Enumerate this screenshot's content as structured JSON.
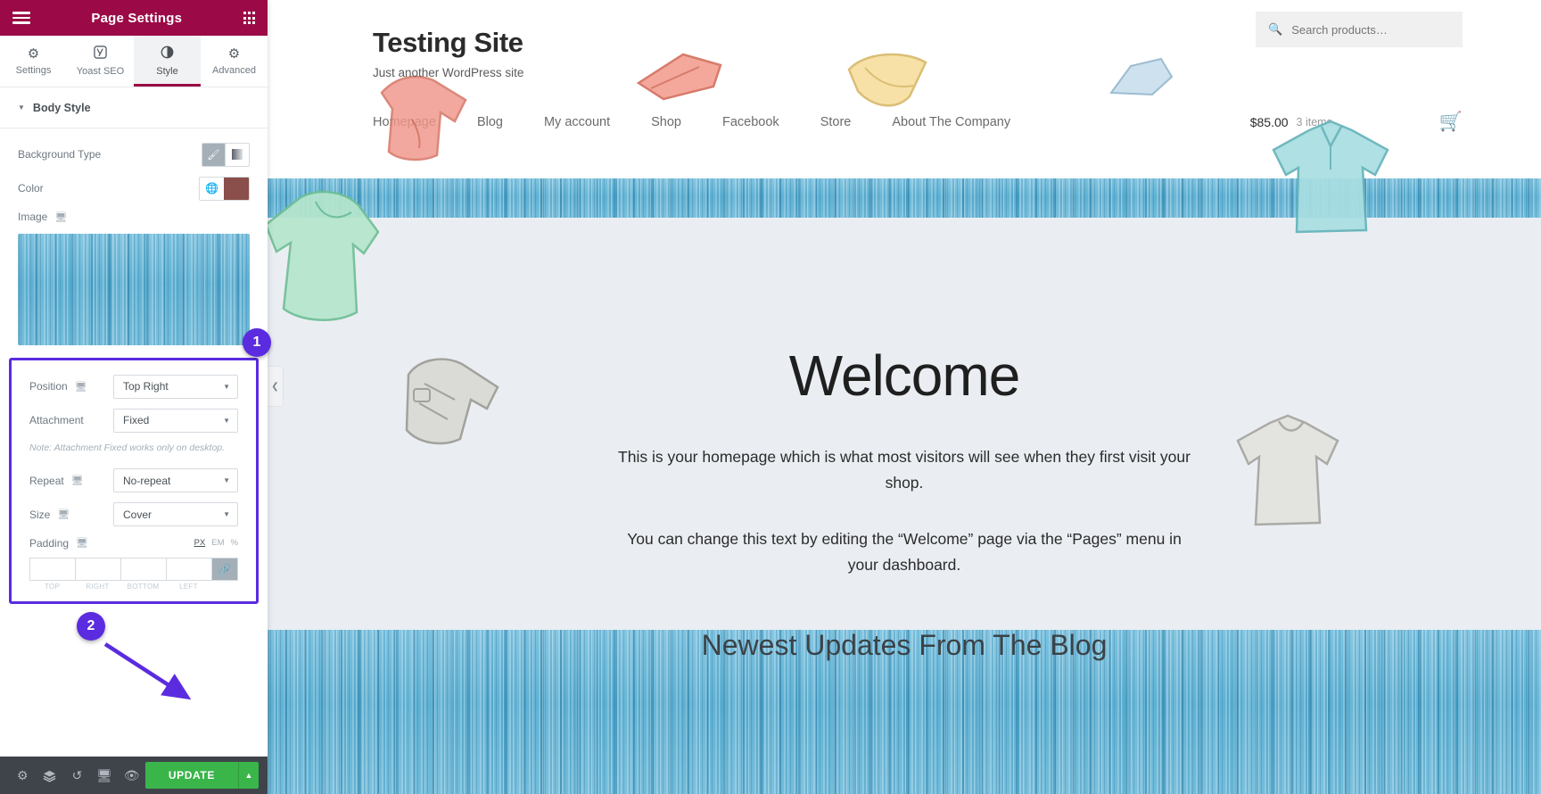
{
  "panel": {
    "header": {
      "title": "Page Settings",
      "menu_icon": "hamburger-icon",
      "apps_icon": "grid-apps-icon"
    },
    "tabs": [
      {
        "label": "Settings",
        "icon": "gear-icon",
        "active": false
      },
      {
        "label": "Yoast SEO",
        "icon": "yoast-logo-icon",
        "active": false
      },
      {
        "label": "Style",
        "icon": "contrast-circle-icon",
        "active": true
      },
      {
        "label": "Advanced",
        "icon": "gear-icon",
        "active": false
      }
    ],
    "section": {
      "title": "Body Style",
      "caret": "▼"
    },
    "controls": {
      "background_type": {
        "label": "Background Type",
        "options": [
          {
            "icon": "brush-icon",
            "selected": true
          },
          {
            "icon": "gradient-icon",
            "selected": false
          }
        ]
      },
      "color": {
        "label": "Color",
        "globe_icon": "globe-icon",
        "value": "#8a4f4a"
      },
      "image": {
        "label": "Image",
        "device_icon": "desktop-icon"
      },
      "position": {
        "label": "Position",
        "device_icon": "desktop-icon",
        "value": "Top Right"
      },
      "attachment": {
        "label": "Attachment",
        "value": "Fixed"
      },
      "attachment_note": "Note: Attachment Fixed works only on desktop.",
      "repeat": {
        "label": "Repeat",
        "device_icon": "desktop-icon",
        "value": "No-repeat"
      },
      "size": {
        "label": "Size",
        "device_icon": "desktop-icon",
        "value": "Cover"
      },
      "padding": {
        "label": "Padding",
        "device_icon": "desktop-icon",
        "units": [
          {
            "label": "PX",
            "selected": true
          },
          {
            "label": "EM",
            "selected": false
          },
          {
            "label": "%",
            "selected": false
          }
        ],
        "fields": [
          {
            "caption": "TOP",
            "value": ""
          },
          {
            "caption": "RIGHT",
            "value": ""
          },
          {
            "caption": "BOTTOM",
            "value": ""
          },
          {
            "caption": "LEFT",
            "value": ""
          }
        ],
        "link_icon": "chain-link-icon"
      }
    },
    "footer": {
      "icons": [
        "gear-icon",
        "layers-icon",
        "history-icon",
        "responsive-desktop-icon",
        "preview-eye-icon"
      ],
      "update_label": "UPDATE",
      "update_caret": "▲",
      "update_color": "#39b54a"
    }
  },
  "preview": {
    "collapse_icon": "chevron-left-icon",
    "site": {
      "title": "Testing Site",
      "tagline": "Just another WordPress site",
      "search": {
        "placeholder": "Search products…",
        "value": "",
        "icon": "search-icon"
      },
      "nav": [
        "Homepage",
        "Blog",
        "My account",
        "Shop",
        "Facebook",
        "Store",
        "About The Company"
      ],
      "cart": {
        "total": "$85.00",
        "items": "3 items",
        "icon": "shopping-basket-icon"
      }
    },
    "hero": {
      "heading": "Welcome",
      "paragraph_1": "This is your homepage which is what most visitors will see when they first visit your shop.",
      "paragraph_2": "You can change this text by editing the “Welcome” page via the “Pages” menu in your dashboard.",
      "background": "#eaeef2"
    },
    "blog_section_heading": "Newest Updates From The Blog"
  },
  "annotations": {
    "color": "#5b2be0",
    "badges": [
      {
        "label": "1"
      },
      {
        "label": "2"
      }
    ]
  }
}
